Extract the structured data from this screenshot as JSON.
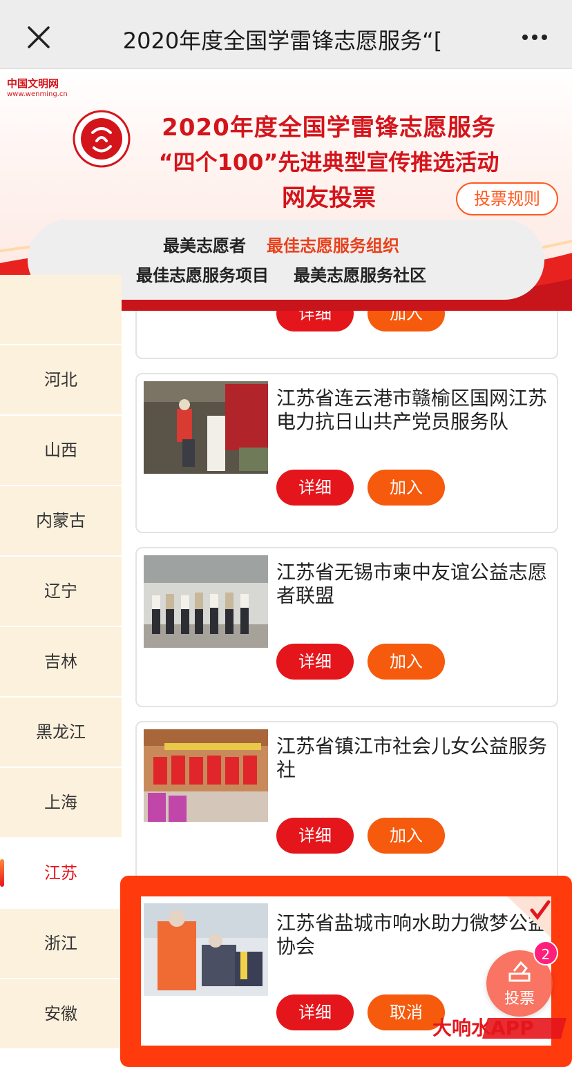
{
  "nav": {
    "title": "2020年度全国学雷锋志愿服务“[",
    "close_icon": "close-icon",
    "more_icon": "more-icon"
  },
  "banner": {
    "site_logo_cn": "中国文明网",
    "site_logo_en": "www.wenming.cn",
    "title_line1": "2020年度全国学雷锋志愿服务",
    "title_line2": "“四个100”先进典型宣传推选活动",
    "title_line3": "网友投票",
    "rules_button": "投票规则",
    "categories": [
      "最美志愿者",
      "最佳志愿服务组织",
      "最佳志愿服务项目",
      "最美志愿服务社区"
    ],
    "active_category": "最佳志愿服务组织",
    "colors": {
      "brand_red": "#d4141b",
      "accent_orange": "#e8411c"
    }
  },
  "sidebar": {
    "items": [
      {
        "label": "河北"
      },
      {
        "label": "山西"
      },
      {
        "label": "内蒙古"
      },
      {
        "label": "辽宁"
      },
      {
        "label": "吉林"
      },
      {
        "label": "黑龙江"
      },
      {
        "label": "上海"
      },
      {
        "label": "江苏",
        "active": true
      },
      {
        "label": "浙江"
      },
      {
        "label": "安徽"
      }
    ]
  },
  "cards": [
    {
      "title": "江苏省连云港市赣榆区国网江苏电力抗日山共产党员服务队",
      "detail_label": "详细",
      "action_label": "加入"
    },
    {
      "title": "江苏省无锡市柬中友谊公益志愿者联盟",
      "detail_label": "详细",
      "action_label": "加入"
    },
    {
      "title": "江苏省镇江市社会儿女公益服务社",
      "detail_label": "详细",
      "action_label": "加入"
    },
    {
      "title": "江苏省盐城市响水助力微梦公益协会",
      "detail_label": "详细",
      "action_label": "取消",
      "selected": true
    }
  ],
  "partial_card": {
    "detail_label": "详细",
    "action_label": "加入"
  },
  "vote_fab": {
    "label": "投票",
    "count": "2"
  },
  "watermark": {
    "text": "大响水APP"
  }
}
